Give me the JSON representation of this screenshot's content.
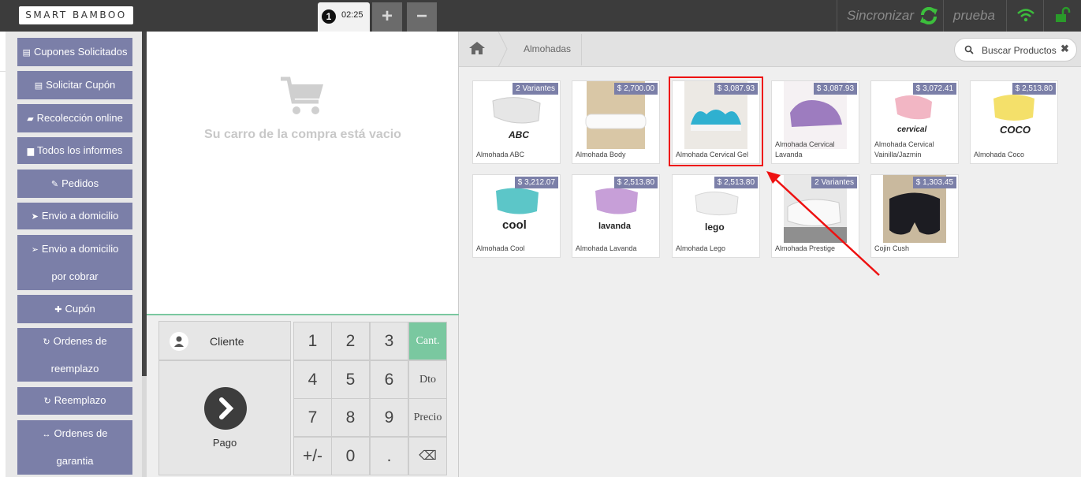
{
  "topbar": {
    "logo": "SMART BAMBOO",
    "order_number": "1",
    "order_time": "02:25",
    "add_label": "+",
    "remove_label": "−",
    "sync_label": "Sincronizar",
    "user_label": "prueba"
  },
  "sidebar": {
    "items": [
      {
        "icon": "ticket-icon",
        "label": "Cupones Solicitados"
      },
      {
        "icon": "ticket-icon",
        "label": "Solicitar Cupón"
      },
      {
        "icon": "bag-icon",
        "label": "Recolección online"
      },
      {
        "icon": "file-icon",
        "label": "Todos los informes"
      },
      {
        "icon": "paperclip-icon",
        "label": "Pedidos"
      },
      {
        "icon": "send-icon",
        "label": "Envio a domicilio"
      },
      {
        "icon": "send-outline-icon",
        "label": "Envio a domicilio",
        "label2": "por cobrar"
      },
      {
        "icon": "gift-icon",
        "label": "Cupón"
      },
      {
        "icon": "refresh-icon",
        "label": "Ordenes de",
        "label2": "reemplazo"
      },
      {
        "icon": "refresh-icon",
        "label": "Reemplazo"
      },
      {
        "icon": "arrows-h-icon",
        "label": "Ordenes de",
        "label2": "garantia"
      }
    ]
  },
  "cart": {
    "empty_text": "Su carro de la compra está vacio"
  },
  "pad": {
    "client_label": "Cliente",
    "pay_label": "Pago",
    "keys": [
      "1",
      "2",
      "3",
      "Cant.",
      "4",
      "5",
      "6",
      "Dto",
      "7",
      "8",
      "9",
      "Precio",
      "+/-",
      "0",
      ".",
      "⌫"
    ]
  },
  "products": {
    "breadcrumb": "Almohadas",
    "search_placeholder": "Buscar Productos",
    "items": [
      {
        "name": "Almohada ABC",
        "price": "2 Variantes"
      },
      {
        "name": "Almohada Body",
        "price": "$ 2,700.00"
      },
      {
        "name": "Almohada Cervical Gel",
        "price": "$ 3,087.93"
      },
      {
        "name": "Almohada Cervical Lavanda",
        "price": "$ 3,087.93"
      },
      {
        "name": "Almohada Cervical Vainilla/Jazmin",
        "price": "$ 3,072.41"
      },
      {
        "name": "Almohada Coco",
        "price": "$ 2,513.80"
      },
      {
        "name": "Almohada Cool",
        "price": "$ 3,212.07"
      },
      {
        "name": "Almohada Lavanda",
        "price": "$ 2,513.80"
      },
      {
        "name": "Almohada Lego",
        "price": "$ 2,513.80"
      },
      {
        "name": "Almohada Prestige",
        "price": "2 Variantes"
      },
      {
        "name": "Cojin Cush",
        "price": "$ 1,303.45"
      }
    ],
    "brand_labels": {
      "abc": "ABC",
      "cervical": "cervical",
      "coco": "COCO",
      "cool": "cool",
      "lavanda": "lavanda",
      "lego": "lego"
    }
  },
  "colors": {
    "accent": "#7b7fa8",
    "green": "#7ac8a0",
    "sync_green": "#3cbf3c",
    "highlight": "#ee1111"
  }
}
